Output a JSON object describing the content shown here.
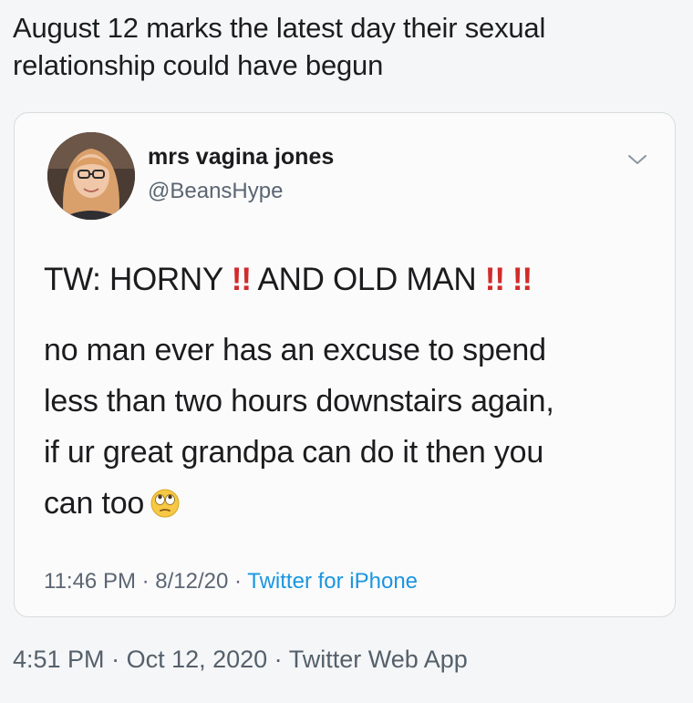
{
  "headline": {
    "line1": "August 12 marks the latest day their sexual",
    "line2": "relationship could have begun"
  },
  "tweet": {
    "display_name": "mrs vagina jones",
    "handle": "@BeansHype",
    "tw_text_1": "TW: HORNY",
    "tw_bang_1": "!!",
    "tw_text_2": " AND OLD MAN",
    "tw_bang_2": "!! !!",
    "body_line1": "no man ever has an excuse to spend",
    "body_line2": "less than two hours downstairs again,",
    "body_line3": "if ur great grandpa can do it then you",
    "body_line4": "can too",
    "emoji": "face-with-rolling-eyes-icon",
    "time": "11:46 PM",
    "date": "8/12/20",
    "source": "Twitter for iPhone",
    "separator": " · "
  },
  "footer": {
    "time": "4:51 PM",
    "date": "Oct 12, 2020",
    "app": "Twitter Web App",
    "separator": " · "
  },
  "colors": {
    "link": "#1b95e0",
    "bang": "#d12b2b",
    "muted": "#5b6672"
  }
}
